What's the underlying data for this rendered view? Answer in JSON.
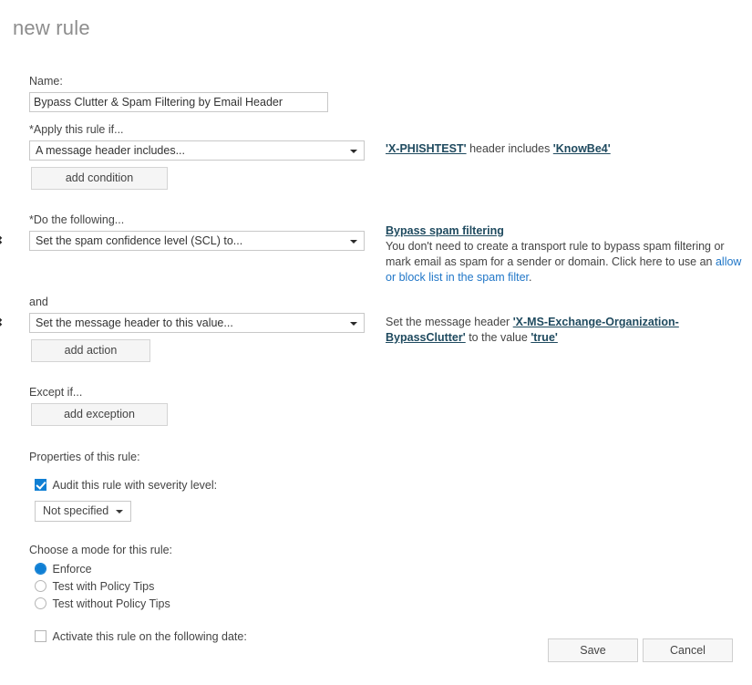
{
  "page": {
    "title": "new rule"
  },
  "form": {
    "name_label": "Name:",
    "name_value": "Bypass Clutter & Spam Filtering by Email Header",
    "name_placeholder": "",
    "apply_label": "*Apply this rule if...",
    "condition_value": "A message header includes...",
    "add_condition_label": "add condition",
    "do_following_label": "*Do the following...",
    "action1_value": "Set the spam confidence level (SCL) to...",
    "and_label": "and",
    "action2_value": "Set the message header to this value...",
    "add_action_label": "add action",
    "except_label": "Except if...",
    "add_exception_label": "add exception",
    "properties_label": "Properties of this rule:",
    "audit_label": "Audit this rule with severity level:",
    "audit_checked": true,
    "severity_value": "Not specified",
    "mode_label": "Choose a mode for this rule:",
    "activate_label": "Activate this rule on the following date:",
    "activate_checked": false,
    "remove_icon": "✖"
  },
  "mode_options": [
    {
      "label": "Enforce",
      "selected": true
    },
    {
      "label": "Test with Policy Tips",
      "selected": false
    },
    {
      "label": "Test without Policy Tips",
      "selected": false
    }
  ],
  "summary": {
    "condition": {
      "header_link": "'X-PHISHTEST'",
      "mid_text": " header includes ",
      "value_link": "'KnowBe4'"
    },
    "spam": {
      "heading_link": "Bypass spam filtering",
      "body_before": "You don't need to create a transport rule to bypass spam filtering or mark email as spam for a sender or domain. Click here to use an ",
      "body_link": "allow or block list in the spam filter",
      "body_after": "."
    },
    "header_action": {
      "before": "Set the message header ",
      "header_link": "'X-MS-Exchange-Organization-BypassClutter'",
      "middle": " to the value ",
      "value_link": "'true'"
    }
  },
  "footer": {
    "save_label": "Save",
    "cancel_label": "Cancel"
  },
  "colors": {
    "accent": "#0f7fd4",
    "link_dark": "#1f4a5f",
    "link_blue": "#2177c8",
    "title_gray": "#8d8d8d"
  }
}
